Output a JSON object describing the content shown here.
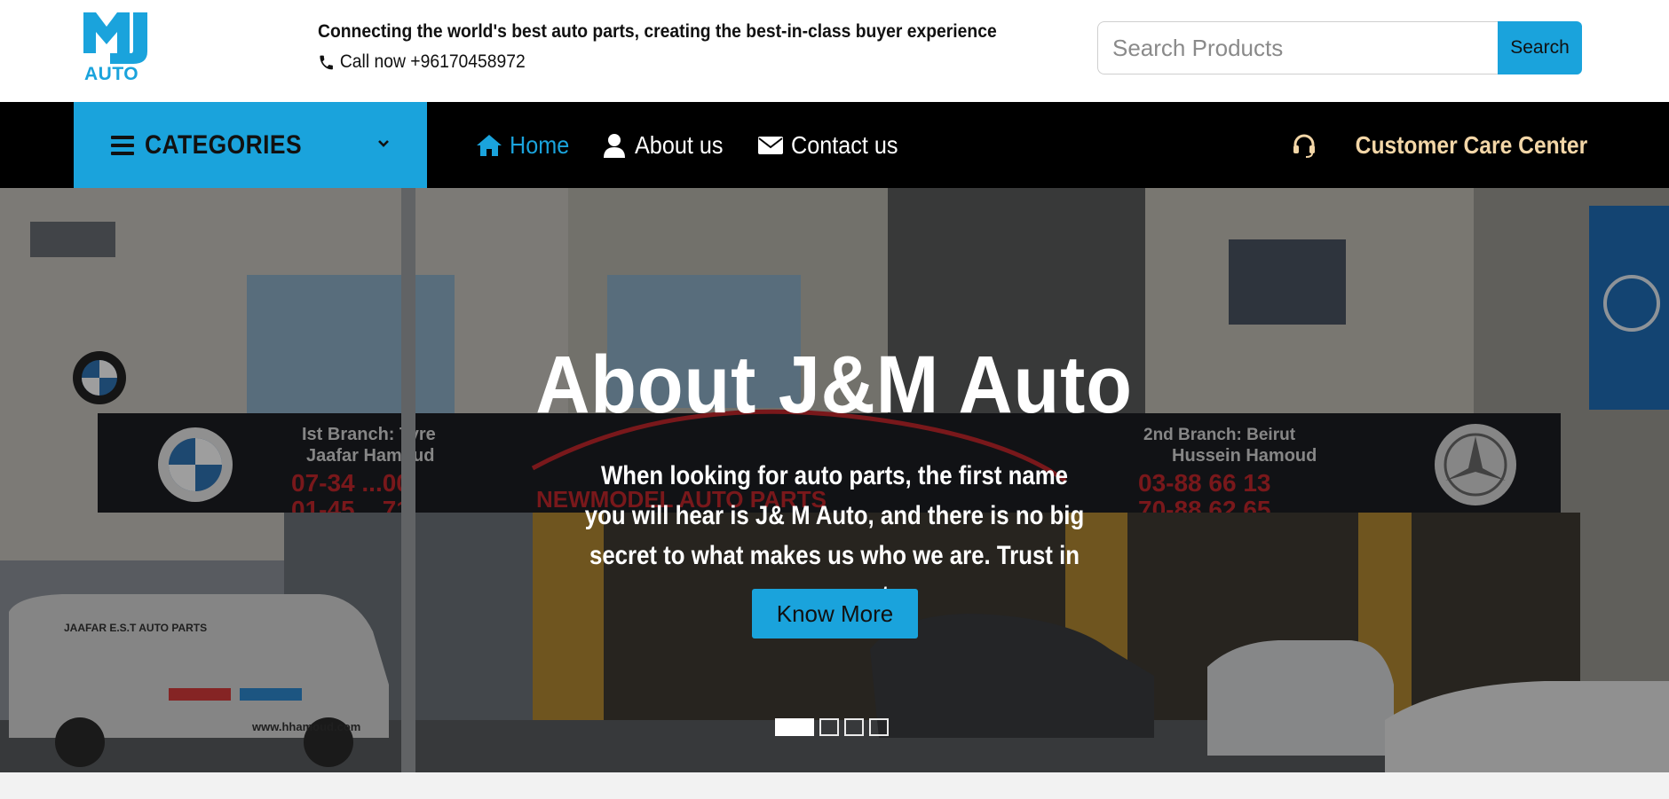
{
  "brand": {
    "logo_text": "AUTO",
    "accent": "#1aa3dc"
  },
  "header": {
    "tagline": "Connecting the world's best auto parts, creating the best-in-class buyer experience",
    "call_now": "Call now +96170458972",
    "search": {
      "placeholder": "Search Products",
      "button_label": "Search"
    }
  },
  "nav": {
    "categories_label": "CATEGORIES",
    "links": [
      {
        "label": "Home",
        "icon": "home-icon",
        "active": true
      },
      {
        "label": "About us",
        "icon": "user-icon",
        "active": false
      },
      {
        "label": "Contact us",
        "icon": "envelope-icon",
        "active": false
      }
    ],
    "customer_care": "Customer Care Center",
    "background": "#000000",
    "care_color": "#f3d6a7"
  },
  "hero": {
    "title": "About J&M Auto",
    "text": "When looking for auto parts, the first name you will hear is J& M Auto, and there is no big secret to what makes us who we are. Trust in every part",
    "button_label": "Know More",
    "slides": 4,
    "active_slide": 1,
    "sign_text": {
      "left_branch": "Ist Branch: Tyre",
      "left_owner": "Jaafar Hamoud",
      "left_phone_1": "07-34 ...00",
      "left_phone_2": "01-45 ...71",
      "center": "NEWMODEL AUTO PARTS",
      "right_branch": "2nd Branch: Beirut",
      "right_owner": "Hussein Hamoud",
      "right_phone_1": "03-88 66 13",
      "right_phone_2": "70-88 62 65",
      "van_text": "JAAFAR E.S.T AUTO PARTS",
      "van_url": "www.hhamoud.com"
    }
  }
}
